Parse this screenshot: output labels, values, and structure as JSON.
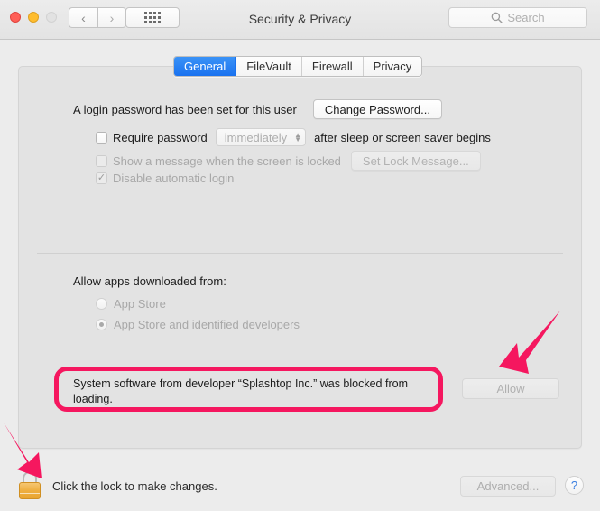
{
  "window": {
    "title": "Security & Privacy",
    "traffic_lights": [
      "close",
      "minimize",
      "zoom-disabled"
    ],
    "nav_back": "‹",
    "nav_forward": "›",
    "show_all_icon": "grid-icon",
    "search": {
      "icon": "search-icon",
      "placeholder": "Search",
      "value": ""
    }
  },
  "tabs": [
    {
      "label": "General",
      "active": true
    },
    {
      "label": "FileVault",
      "active": false
    },
    {
      "label": "Firewall",
      "active": false
    },
    {
      "label": "Privacy",
      "active": false
    }
  ],
  "general": {
    "password_status": "A login password has been set for this user",
    "change_password_button": "Change Password...",
    "require_password": {
      "label": "Require password",
      "checked": false,
      "delay_value": "immediately",
      "suffix": "after sleep or screen saver begins"
    },
    "lock_message": {
      "label": "Show a message when the screen is locked",
      "checked": false,
      "button": "Set Lock Message..."
    },
    "disable_auto_login": {
      "label": "Disable automatic login",
      "checked": true
    },
    "allow_apps": {
      "heading": "Allow apps downloaded from:",
      "options": [
        {
          "label": "App Store",
          "selected": false
        },
        {
          "label": "App Store and identified developers",
          "selected": true
        }
      ]
    },
    "blocked_notice": {
      "text": "System software from developer “Splashtop Inc.” was blocked from loading.",
      "highlight_color": "#f5175f"
    },
    "allow_button": {
      "label": "Allow",
      "enabled": false
    }
  },
  "footer": {
    "lock_icon": "lock-closed-icon",
    "lock_text": "Click the lock to make changes.",
    "advanced_button": "Advanced...",
    "help_button": "?"
  },
  "annotations": {
    "arrow_color": "#f5175f",
    "arrows": [
      {
        "name": "arrow-to-lock",
        "direction": "down-right"
      },
      {
        "name": "arrow-to-allow-button",
        "direction": "down-left"
      }
    ]
  }
}
